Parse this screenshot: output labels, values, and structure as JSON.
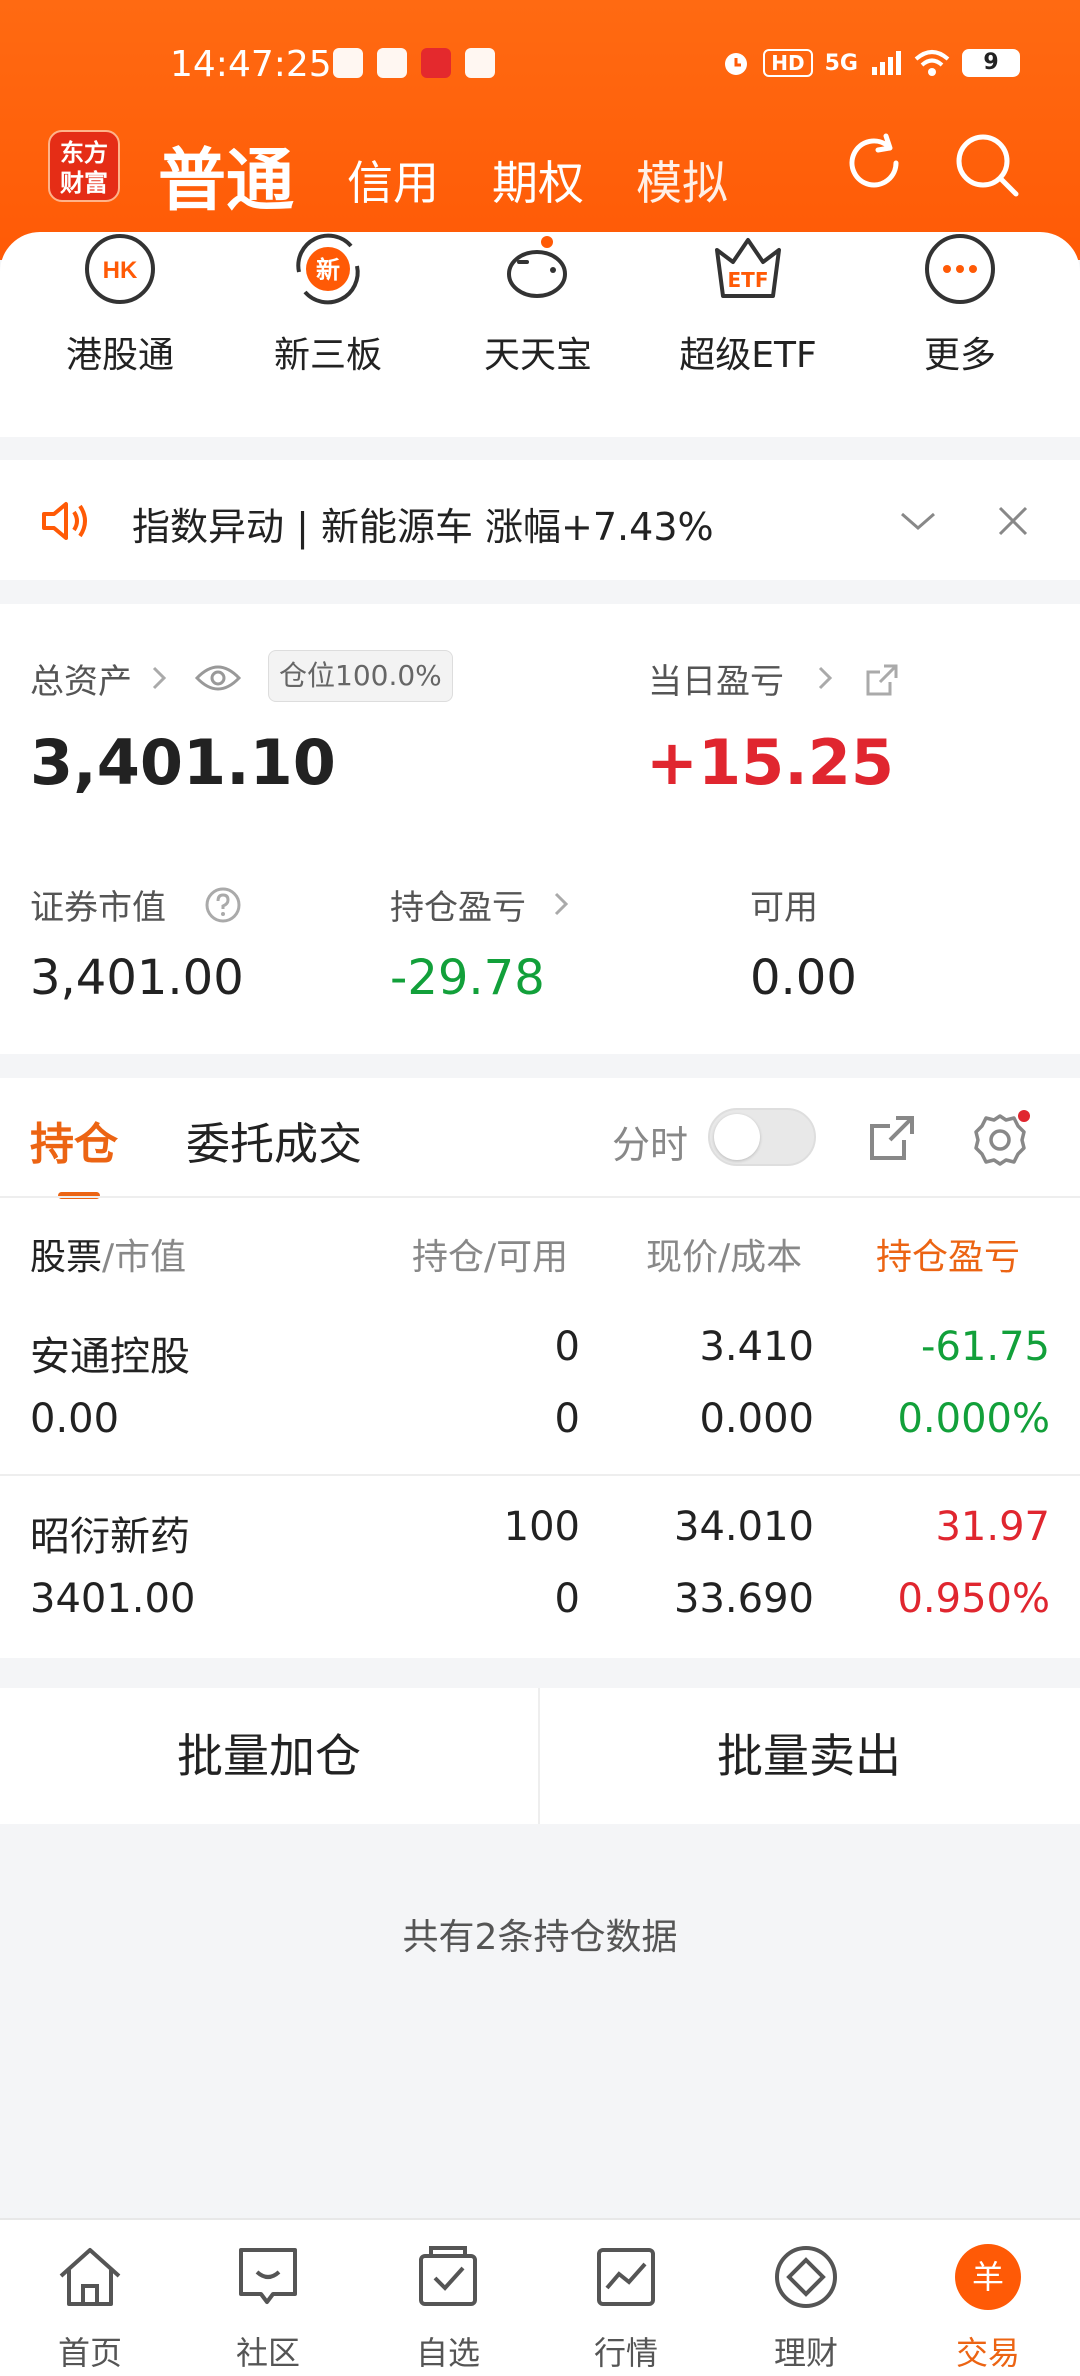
{
  "status_bar": {
    "time": "14:47:25",
    "badge_hd": "HD",
    "network": "5G",
    "battery": "9"
  },
  "header": {
    "logo_line1": "东方",
    "logo_line2": "财富",
    "tabs": [
      "普通",
      "信用",
      "期权",
      "模拟"
    ],
    "active_tab": "普通"
  },
  "quick_menu": [
    {
      "label": "港股通",
      "icon": "hk-icon",
      "glyph": "HK"
    },
    {
      "label": "新三板",
      "icon": "new-board-icon",
      "glyph": "新"
    },
    {
      "label": "天天宝",
      "icon": "piggy-bank-icon"
    },
    {
      "label": "超级ETF",
      "icon": "etf-crown-icon",
      "glyph": "ETF"
    },
    {
      "label": "更多",
      "icon": "more-dots-icon"
    }
  ],
  "notice": {
    "text": "指数异动 | 新能源车 涨幅+7.43%"
  },
  "assets": {
    "total_label": "总资产",
    "total_value": "3,401.10",
    "position_badge": "仓位100.0%",
    "daily_pnl_label": "当日盈亏",
    "daily_pnl_value": "+15.25",
    "market_value_label": "证券市值",
    "market_value": "3,401.00",
    "holding_pnl_label": "持仓盈亏",
    "holding_pnl": "-29.78",
    "available_label": "可用",
    "available": "0.00"
  },
  "holdings": {
    "tabs": [
      "持仓",
      "委托成交"
    ],
    "fenshi_label": "分时",
    "toggle_on": false,
    "columns": {
      "c1a": "股票",
      "c1b": "/市值",
      "c2": "持仓/可用",
      "c3": "现价/成本",
      "c4": "持仓盈亏"
    },
    "rows": [
      {
        "name": "安通控股",
        "market_value": "0.00",
        "position": "0",
        "available": "0",
        "price": "3.410",
        "cost": "0.000",
        "pnl": "-61.75",
        "pnl_pct": "0.000%",
        "pnl_color": "green",
        "pct_color": "green"
      },
      {
        "name": "昭衍新药",
        "market_value": "3401.00",
        "position": "100",
        "available": "0",
        "price": "34.010",
        "cost": "33.690",
        "pnl": "31.97",
        "pnl_pct": "0.950%",
        "pnl_color": "red",
        "pct_color": "red"
      }
    ]
  },
  "batch": {
    "add": "批量加仓",
    "sell": "批量卖出"
  },
  "count_text": "共有2条持仓数据",
  "bottom_nav": [
    {
      "label": "首页",
      "icon": "home-icon"
    },
    {
      "label": "社区",
      "icon": "community-icon"
    },
    {
      "label": "自选",
      "icon": "watchlist-icon"
    },
    {
      "label": "行情",
      "icon": "market-icon"
    },
    {
      "label": "理财",
      "icon": "finance-icon"
    },
    {
      "label": "交易",
      "icon": "trade-icon",
      "active": true,
      "glyph": "羊"
    }
  ],
  "colors": {
    "brand": "#ff5a06",
    "active": "#ec6413",
    "up": "#e0262f",
    "down": "#12a03a"
  }
}
